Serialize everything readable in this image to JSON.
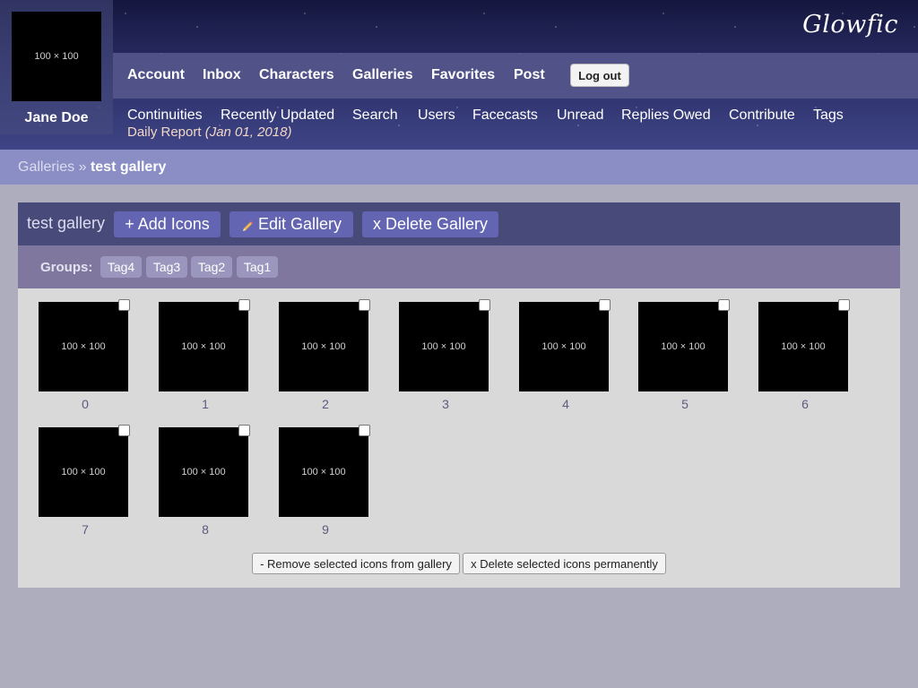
{
  "user": {
    "name": "Jane Doe",
    "avatar_placeholder": "100 × 100"
  },
  "logo": "Glowfic",
  "nav": {
    "primary": [
      "Account",
      "Inbox",
      "Characters",
      "Galleries",
      "Favorites",
      "Post"
    ],
    "logout_label": "Log out",
    "secondary": [
      "Continuities",
      "Recently Updated",
      "Search",
      "Users",
      "Facecasts",
      "Unread",
      "Replies Owed",
      "Contribute",
      "Tags"
    ],
    "daily_report_label": "Daily Report",
    "daily_report_date": "(Jan 01, 2018)"
  },
  "breadcrumb": {
    "parent": "Galleries",
    "separator": "»",
    "current": "test gallery"
  },
  "gallery": {
    "title": "test gallery",
    "add_icons_label": "+ Add Icons",
    "edit_label": "Edit Gallery",
    "delete_label": "x Delete Gallery",
    "groups_label": "Groups:",
    "tags": [
      "Tag4",
      "Tag3",
      "Tag2",
      "Tag1"
    ],
    "icon_placeholder": "100 × 100",
    "icons": [
      "0",
      "1",
      "2",
      "3",
      "4",
      "5",
      "6",
      "7",
      "8",
      "9"
    ]
  },
  "actions": {
    "remove_label": "- Remove selected icons from gallery",
    "delete_label": "x Delete selected icons permanently"
  }
}
